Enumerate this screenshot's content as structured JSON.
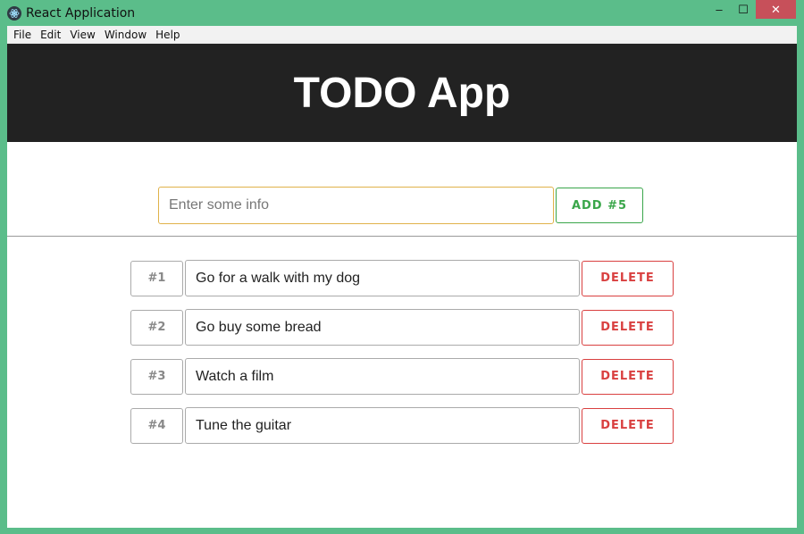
{
  "window": {
    "title": "React Application",
    "minimize_label": "–",
    "maximize_label": "☐",
    "close_label": "✕"
  },
  "menubar": {
    "items": [
      "File",
      "Edit",
      "View",
      "Window",
      "Help"
    ]
  },
  "header": {
    "title": "TODO App"
  },
  "new_todo": {
    "placeholder": "Enter some info",
    "value": "",
    "add_label": "ADD #5"
  },
  "todos": [
    {
      "number": "#1",
      "text": "Go for a walk with my dog",
      "delete_label": "DELETE"
    },
    {
      "number": "#2",
      "text": "Go buy some bread",
      "delete_label": "DELETE"
    },
    {
      "number": "#3",
      "text": "Watch a film",
      "delete_label": "DELETE"
    },
    {
      "number": "#4",
      "text": "Tune the guitar",
      "delete_label": "DELETE"
    }
  ],
  "colors": {
    "frame": "#5bbd8a",
    "header_bg": "#222222",
    "add_accent": "#3aa64a",
    "delete_accent": "#d94040",
    "input_focus_border": "#e0b24a"
  }
}
